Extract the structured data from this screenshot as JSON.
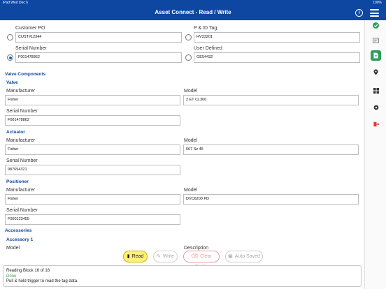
{
  "status_bar": {
    "left": "iPad  Wed Dec 6",
    "right": "100%"
  },
  "nav": {
    "title": "Asset Connect - Read / Write",
    "info_icon": "info-icon",
    "menu_icon": "hamburger-menu-icon"
  },
  "tag_fields": {
    "customer_po": {
      "label": "Customer PO",
      "value": "CUST#12344"
    },
    "pid_tag": {
      "label": "P & ID Tag",
      "value": "HV33201"
    },
    "serial_number": {
      "label": "Serial Number",
      "value": "F001478862"
    },
    "user_defined": {
      "label": "User Defined",
      "value": "GE54432"
    },
    "selected": "serial_number"
  },
  "valve_components": {
    "title": "Valve Components",
    "valve": {
      "title": "Valve",
      "manufacturer_label": "Manufacturer",
      "manufacturer": "Fisher",
      "model_label": "Model",
      "model": "2 ET CL300",
      "serial_label": "Serial Number",
      "serial": "F001478862"
    },
    "actuator": {
      "title": "Actuator",
      "manufacturer_label": "Manufacturer",
      "manufacturer": "Fisher",
      "model_label": "Model",
      "model": "667 Sz 45",
      "serial_label": "Serial Number",
      "serial": "987654321"
    },
    "positioner": {
      "title": "Positioner",
      "manufacturer_label": "Manufacturer",
      "manufacturer": "Fisher",
      "model_label": "Model",
      "model": "DVC6200 PD",
      "serial_label": "Serial Number",
      "serial": "F000123455"
    }
  },
  "accessories": {
    "title": "Accessories",
    "accessory_1": {
      "title": "Accessory 1",
      "model_label": "Model",
      "description_label": "Description"
    }
  },
  "toolbar": {
    "read": "Read",
    "write": "Write",
    "clear_fields": "Clear Fields",
    "auto_saved": "Auto Saved"
  },
  "log": {
    "line1": "Reading Block 16 of 16",
    "line2": "Done",
    "line3": "Pull & hold trigger to read the tag data."
  },
  "rail": {
    "items": [
      "check-icon",
      "tag-icon",
      "document-icon",
      "location-icon",
      "grid-icon",
      "settings-icon",
      "logout-icon"
    ]
  },
  "colors": {
    "brand": "#0d47a1",
    "read_button": "#fff176",
    "done": "#43a047",
    "doc_active": "#2e9e5b"
  }
}
